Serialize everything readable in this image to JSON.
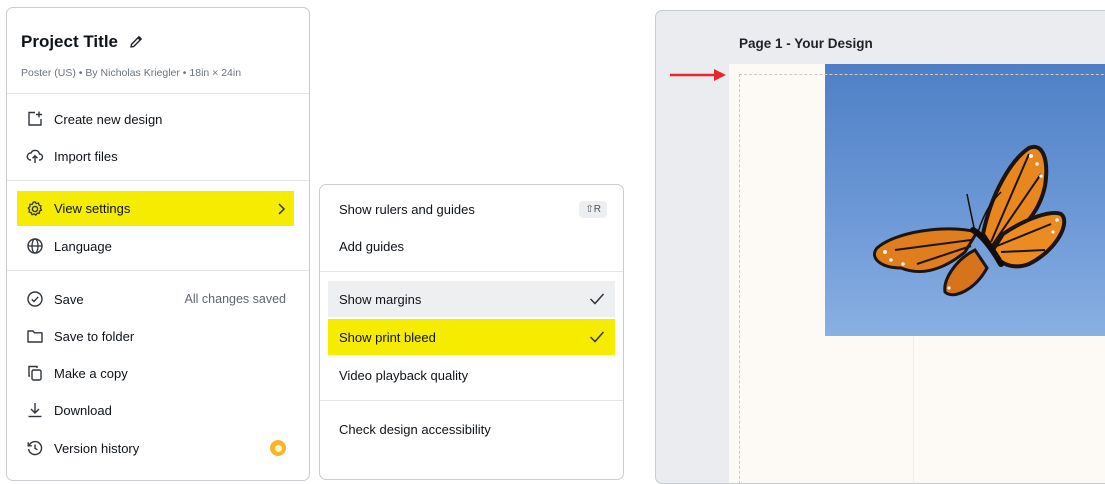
{
  "project": {
    "title": "Project Title",
    "subtitle": "Poster (US) • By Nicholas Kriegler • 18in × 24in"
  },
  "menu": {
    "items": [
      {
        "label": "Create new design",
        "icon": "plus-square-icon"
      },
      {
        "label": "Import files",
        "icon": "cloud-upload-icon"
      },
      {
        "label": "View settings",
        "icon": "gear-icon",
        "highlighted": true
      },
      {
        "label": "Language",
        "icon": "globe-icon"
      },
      {
        "label": "Save",
        "icon": "cloud-check-icon",
        "status": "All changes saved"
      },
      {
        "label": "Save to folder",
        "icon": "folder-icon"
      },
      {
        "label": "Make a copy",
        "icon": "copy-icon"
      },
      {
        "label": "Download",
        "icon": "download-icon"
      },
      {
        "label": "Version history",
        "icon": "history-icon",
        "badge": "crown-icon"
      }
    ]
  },
  "view_settings": {
    "items": [
      {
        "label": "Show rulers and guides",
        "shortcut": "⇧R"
      },
      {
        "label": "Add guides"
      },
      {
        "label": "Show margins",
        "checked": true
      },
      {
        "label": "Show print bleed",
        "checked": true,
        "highlighted": true
      },
      {
        "label": "Video playback quality"
      },
      {
        "label": "Check design accessibility"
      }
    ]
  },
  "canvas": {
    "page_label": "Page 1 - Your Design"
  },
  "colors": {
    "highlight": "#f5ec00",
    "arrow": "#e8262c",
    "sky": "#6c98d6",
    "canvas_bg": "#ebecf0",
    "page_bg": "#fdfaf6"
  }
}
